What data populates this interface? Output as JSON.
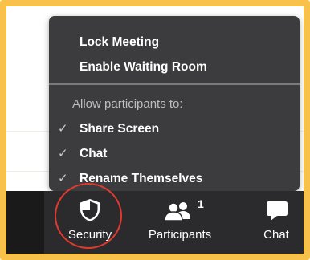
{
  "security_menu": {
    "items": [
      {
        "label": "Lock Meeting"
      },
      {
        "label": "Enable Waiting Room"
      }
    ],
    "section_header": "Allow participants to:",
    "options": [
      {
        "label": "Share Screen",
        "checked": true,
        "check_glyph": "✓"
      },
      {
        "label": "Chat",
        "checked": true,
        "check_glyph": "✓"
      },
      {
        "label": "Rename Themselves",
        "checked": true,
        "check_glyph": "✓"
      }
    ]
  },
  "toolbar": {
    "security": {
      "label": "Security",
      "icon": "shield-icon"
    },
    "participants": {
      "label": "Participants",
      "icon": "participants-icon",
      "count": "1"
    },
    "chat": {
      "label": "Chat",
      "icon": "chat-icon"
    }
  },
  "colors": {
    "highlight_frame": "#F8C14A",
    "highlight_circle": "#E03A2E",
    "menu_background": "#3c3c3e",
    "toolbar_background": "#2b2b2d"
  }
}
